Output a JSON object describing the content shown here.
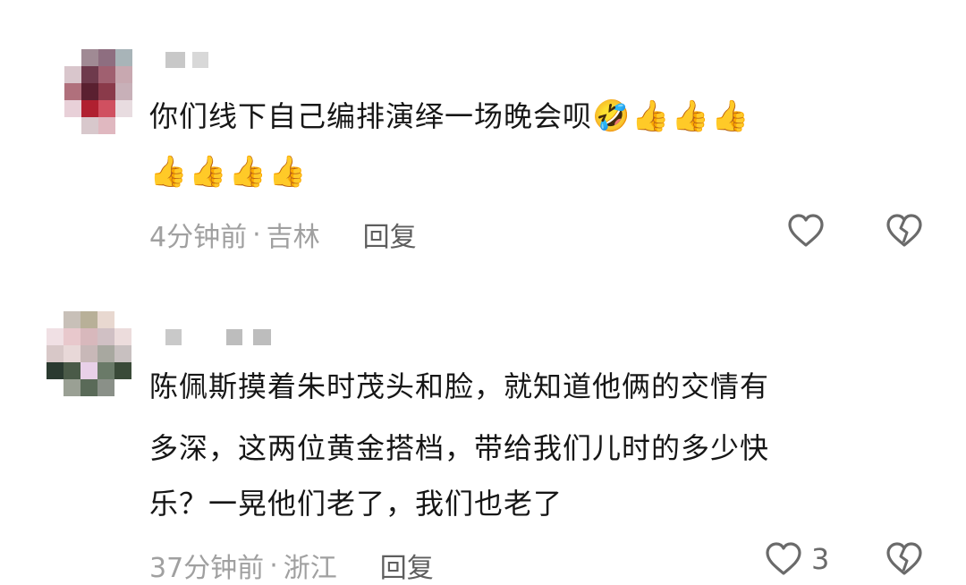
{
  "comments": [
    {
      "line1": "你们线下自己编排演绎一场晚会呗",
      "emoji_line1": "🤣👍👍👍",
      "emoji_line2": "👍👍👍👍",
      "time": "4分钟前",
      "location": "吉林",
      "reply_label": "回复",
      "like_icon": "heart-outline-icon",
      "dislike_icon": "broken-heart-icon"
    },
    {
      "line1": "陈佩斯摸着朱时茂头和脸，就知道他俩的交情有",
      "line2": "多深，这两位黄金搭档，带给我们儿时的多少快",
      "line3": "乐？一晃他们老了，我们也老了",
      "time": "37分钟前",
      "location": "浙江",
      "reply_label": "回复",
      "like_count": "3",
      "like_icon": "heart-outline-icon",
      "dislike_icon": "broken-heart-icon"
    }
  ],
  "separator": "·"
}
